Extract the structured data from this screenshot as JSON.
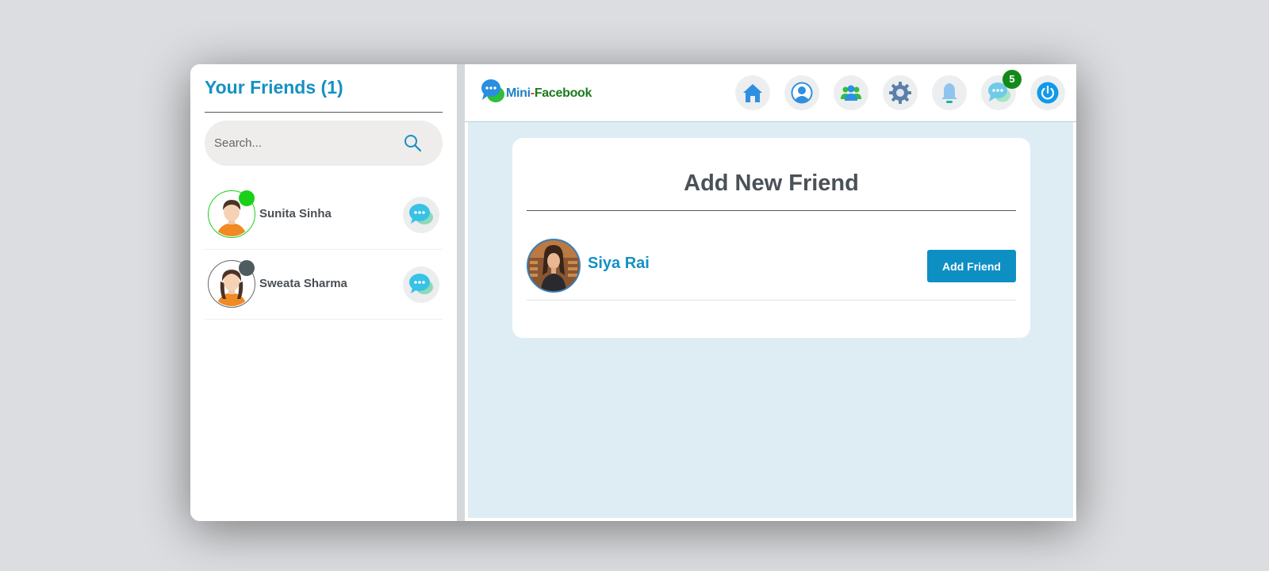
{
  "sidebar": {
    "title": "Your Friends (1)",
    "search": {
      "placeholder": "Search..."
    },
    "friends": [
      {
        "name": "Sunita Sinha",
        "status": "online",
        "status_color": "#19d119"
      },
      {
        "name": "Sweata Sharma",
        "status": "offline",
        "status_color": "#4f5b60"
      }
    ]
  },
  "topbar": {
    "logo": {
      "part1": "Mini",
      "part2": "-",
      "part3": "Facebook"
    },
    "nav": [
      {
        "icon": "home-icon"
      },
      {
        "icon": "profile-icon"
      },
      {
        "icon": "friends-icon"
      },
      {
        "icon": "settings-icon"
      },
      {
        "icon": "notifications-icon"
      },
      {
        "icon": "messages-icon",
        "badge": "5"
      },
      {
        "icon": "power-icon"
      }
    ]
  },
  "card": {
    "title": "Add New Friend",
    "suggestions": [
      {
        "name": "Siya Rai",
        "button_label": "Add Friend"
      }
    ]
  },
  "colors": {
    "accent": "#1590c4",
    "main_background": "#ddedf3",
    "badge": "#138a18"
  }
}
